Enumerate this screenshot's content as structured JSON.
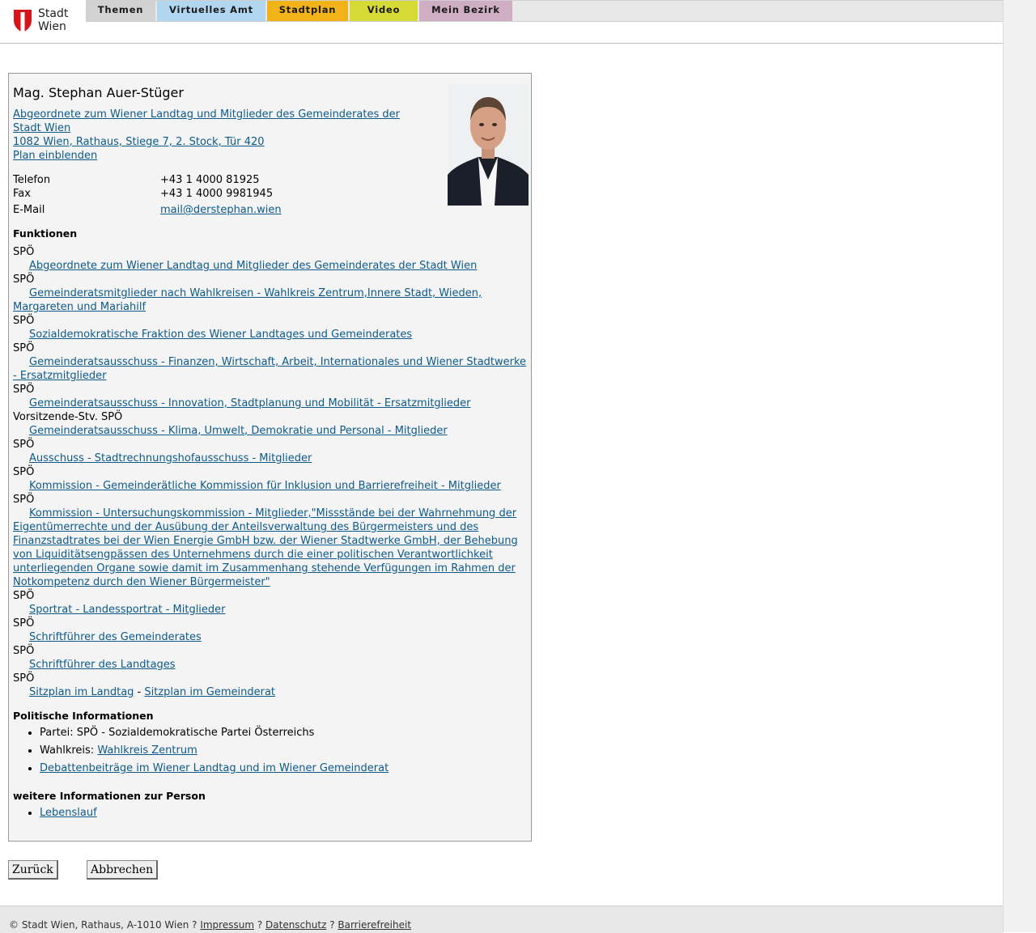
{
  "logo": {
    "line1": "Stadt",
    "line2": "Wien"
  },
  "nav": {
    "tabs": [
      {
        "label": "Themen",
        "color": "#d2d2d2"
      },
      {
        "label": "Virtuelles Amt",
        "color": "#b0d6f0"
      },
      {
        "label": "Stadtplan",
        "color": "#f2b319"
      },
      {
        "label": "Video",
        "color": "#d7d936"
      },
      {
        "label": "Mein Bezirk",
        "color": "#cfaec3"
      }
    ]
  },
  "person": {
    "name": "Mag. Stephan Auer-Stüger",
    "role_link": "Abgeordnete zum Wiener Landtag und Mitglieder des Gemeinderates der Stadt Wien",
    "address_link": "1082 Wien, Rathaus, Stiege 7, 2. Stock, Tür 420",
    "plan_link": "Plan einblenden",
    "contact": {
      "phone_label": "Telefon",
      "phone": "+43 1 4000 81925",
      "fax_label": "Fax",
      "fax": "+43 1 4000 9981945",
      "email_label": "E-Mail",
      "email": "mail@derstephan.wien"
    }
  },
  "funktionen": {
    "heading": "Funktionen",
    "items": [
      {
        "org": "SPÖ",
        "function": "Abgeordnete zum Wiener Landtag und Mitglieder des Gemeinderates der Stadt Wien"
      },
      {
        "org": "SPÖ",
        "function": "Gemeinderatsmitglieder nach Wahlkreisen - Wahlkreis Zentrum,Innere Stadt, Wieden, Margareten und Mariahilf"
      },
      {
        "org": "SPÖ",
        "function": "Sozialdemokratische Fraktion des Wiener Landtages und Gemeinderates"
      },
      {
        "org": "SPÖ",
        "function": "Gemeinderatsausschuss - Finanzen, Wirtschaft, Arbeit, Internationales und Wiener Stadtwerke - Ersatzmitglieder"
      },
      {
        "org": "SPÖ",
        "function": "Gemeinderatsausschuss - Innovation, Stadtplanung und Mobilität - Ersatzmitglieder"
      },
      {
        "org": "Vorsitzende-Stv. SPÖ",
        "function": "Gemeinderatsausschuss - Klima, Umwelt, Demokratie und Personal - Mitglieder"
      },
      {
        "org": "SPÖ",
        "function": "Ausschuss - Stadtrechnungshofausschuss - Mitglieder"
      },
      {
        "org": "SPÖ",
        "function": "Kommission - Gemeinderätliche Kommission für Inklusion und Barrierefreiheit - Mitglieder"
      },
      {
        "org": "SPÖ",
        "function": "Kommission - Untersuchungskommission - Mitglieder,\"Missstände bei der Wahrnehmung der Eigentümerrechte und der Ausübung der Anteilsverwaltung des Bürgermeisters und des Finanzstadtrates bei der Wien Energie GmbH bzw. der Wiener Stadtwerke GmbH, der Behebung von Liquiditätsengpässen des Unternehmens durch die einer politischen Verantwortlichkeit unterliegenden Organe sowie damit im Zusammenhang stehende Verfügungen im Rahmen der Notkompetenz durch den Wiener Bürgermeister\""
      },
      {
        "org": "SPÖ",
        "function": "Sportrat - Landessportrat - Mitglieder"
      },
      {
        "org": "SPÖ",
        "function": "Schriftführer des Gemeinderates"
      },
      {
        "org": "SPÖ",
        "function": "Schriftführer des Landtages"
      }
    ],
    "last_org": "SPÖ",
    "sitzplan_landtag": "Sitzplan im Landtag",
    "sitzplan_separator": " - ",
    "sitzplan_gemeinderat": "Sitzplan im Gemeinderat"
  },
  "politisch": {
    "heading": "Politische Informationen",
    "partei": "Partei: SPÖ - Sozialdemokratische Partei Österreichs",
    "wahlkreis_label": "Wahlkreis: ",
    "wahlkreis_link": "Wahlkreis Zentrum",
    "debatten_link": "Debattenbeiträge im Wiener Landtag und im Wiener Gemeinderat"
  },
  "weitere": {
    "heading": "weitere Informationen zur Person",
    "lebenslauf": "Lebenslauf"
  },
  "buttons": {
    "back": "Zurück",
    "cancel": "Abbrechen"
  },
  "footer": {
    "copyright": "© Stadt Wien, Rathaus, A-1010 Wien ? ",
    "impressum": "Impressum",
    "sep1": " ? ",
    "datenschutz": "Datenschutz",
    "sep2": " ? ",
    "barrierefreiheit": "Barrierefreiheit"
  }
}
